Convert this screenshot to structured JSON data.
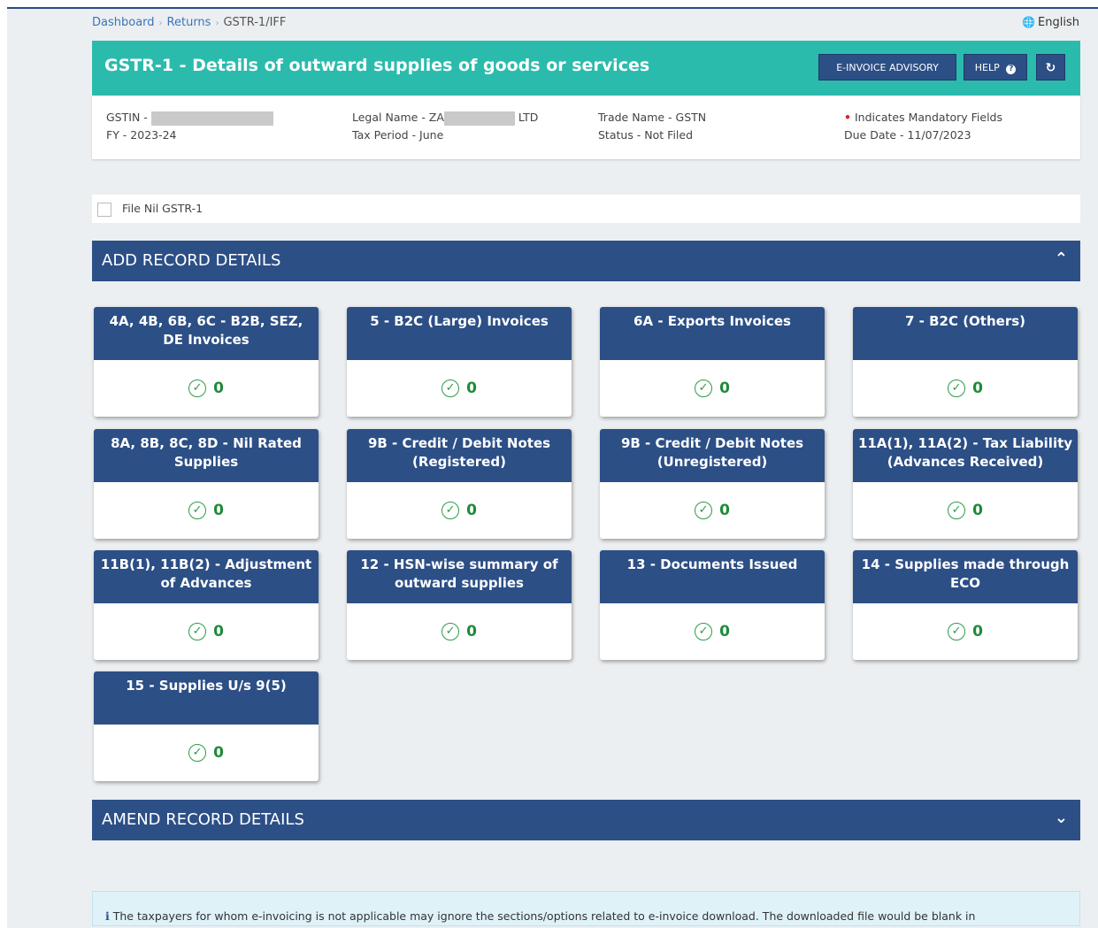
{
  "breadcrumb": [
    "Dashboard",
    "Returns",
    "GSTR-1/IFF"
  ],
  "language": "English",
  "header": {
    "title": "GSTR-1 - Details of outward supplies of goods or services",
    "einvoice_btn": "E-INVOICE ADVISORY",
    "help_btn": "HELP",
    "refresh_icon": "refresh-icon"
  },
  "info": {
    "gstin_label": "GSTIN -",
    "fy": "FY - 2023-24",
    "legal_name_prefix": "Legal Name - ZA",
    "legal_name_suffix": "LTD",
    "tax_period": "Tax Period - June",
    "trade_name": "Trade Name - GSTN",
    "status": "Status - Not Filed",
    "mandatory": "Indicates Mandatory Fields",
    "due_date": "Due Date - 11/07/2023"
  },
  "nil_label": "File Nil GSTR-1",
  "add_section": "ADD RECORD DETAILS",
  "amend_section": "AMEND RECORD DETAILS",
  "tiles": [
    {
      "title": "4A, 4B, 6B, 6C - B2B, SEZ, DE Invoices",
      "count": "0"
    },
    {
      "title": "5 - B2C (Large) Invoices",
      "count": "0"
    },
    {
      "title": "6A - Exports Invoices",
      "count": "0"
    },
    {
      "title": "7 - B2C (Others)",
      "count": "0"
    },
    {
      "title": "8A, 8B, 8C, 8D - Nil Rated Supplies",
      "count": "0"
    },
    {
      "title": "9B - Credit / Debit Notes (Registered)",
      "count": "0"
    },
    {
      "title": "9B - Credit / Debit Notes (Unregistered)",
      "count": "0"
    },
    {
      "title": "11A(1), 11A(2) - Tax Liability (Advances Received)",
      "count": "0"
    },
    {
      "title": "11B(1), 11B(2) - Adjustment of Advances",
      "count": "0"
    },
    {
      "title": "12 - HSN-wise summary of outward supplies",
      "count": "0"
    },
    {
      "title": "13 - Documents Issued",
      "count": "0"
    },
    {
      "title": "14 - Supplies made through ECO",
      "count": "0"
    },
    {
      "title": "15 - Supplies U/s 9(5)",
      "count": "0"
    }
  ],
  "advisory_text": "The taxpayers for whom e-invoicing is not applicable may ignore the sections/options related to e-invoice download. The downloaded file would be blank in"
}
